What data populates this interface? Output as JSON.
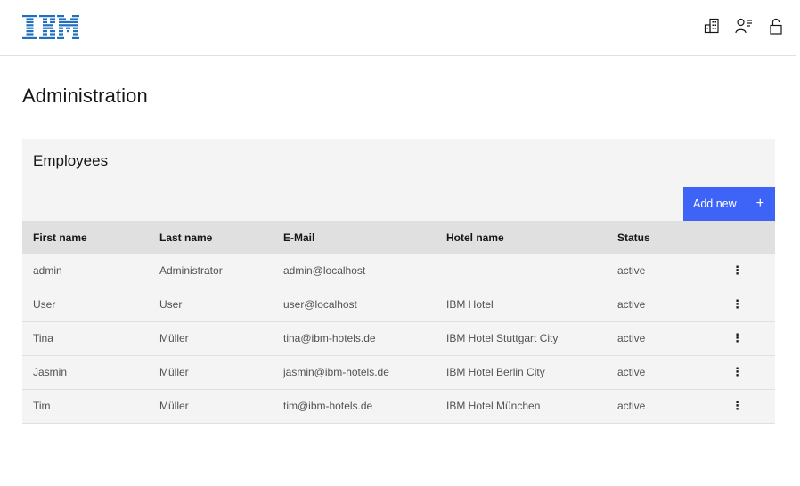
{
  "header": {
    "logo_text": "IBM",
    "icons": [
      "hotel-building-icon",
      "user-list-icon",
      "unlock-icon"
    ]
  },
  "page": {
    "title": "Administration"
  },
  "panel": {
    "title": "Employees",
    "add_button_label": "Add new",
    "add_button_icon": "+",
    "accent_color": "#3d63f7"
  },
  "table": {
    "columns": [
      "First name",
      "Last name",
      "E-Mail",
      "Hotel name",
      "Status"
    ],
    "rows": [
      {
        "first": "admin",
        "last": "Administrator",
        "email": "admin@localhost",
        "hotel": "",
        "status": "active"
      },
      {
        "first": "User",
        "last": "User",
        "email": "user@localhost",
        "hotel": "IBM Hotel",
        "status": "active"
      },
      {
        "first": "Tina",
        "last": "Müller",
        "email": "tina@ibm-hotels.de",
        "hotel": "IBM Hotel Stuttgart City",
        "status": "active"
      },
      {
        "first": "Jasmin",
        "last": "Müller",
        "email": "jasmin@ibm-hotels.de",
        "hotel": "IBM Hotel Berlin City",
        "status": "active"
      },
      {
        "first": "Tim",
        "last": "Müller",
        "email": "tim@ibm-hotels.de",
        "hotel": "IBM Hotel München",
        "status": "active"
      }
    ],
    "row_menu_icon": "⋮"
  }
}
